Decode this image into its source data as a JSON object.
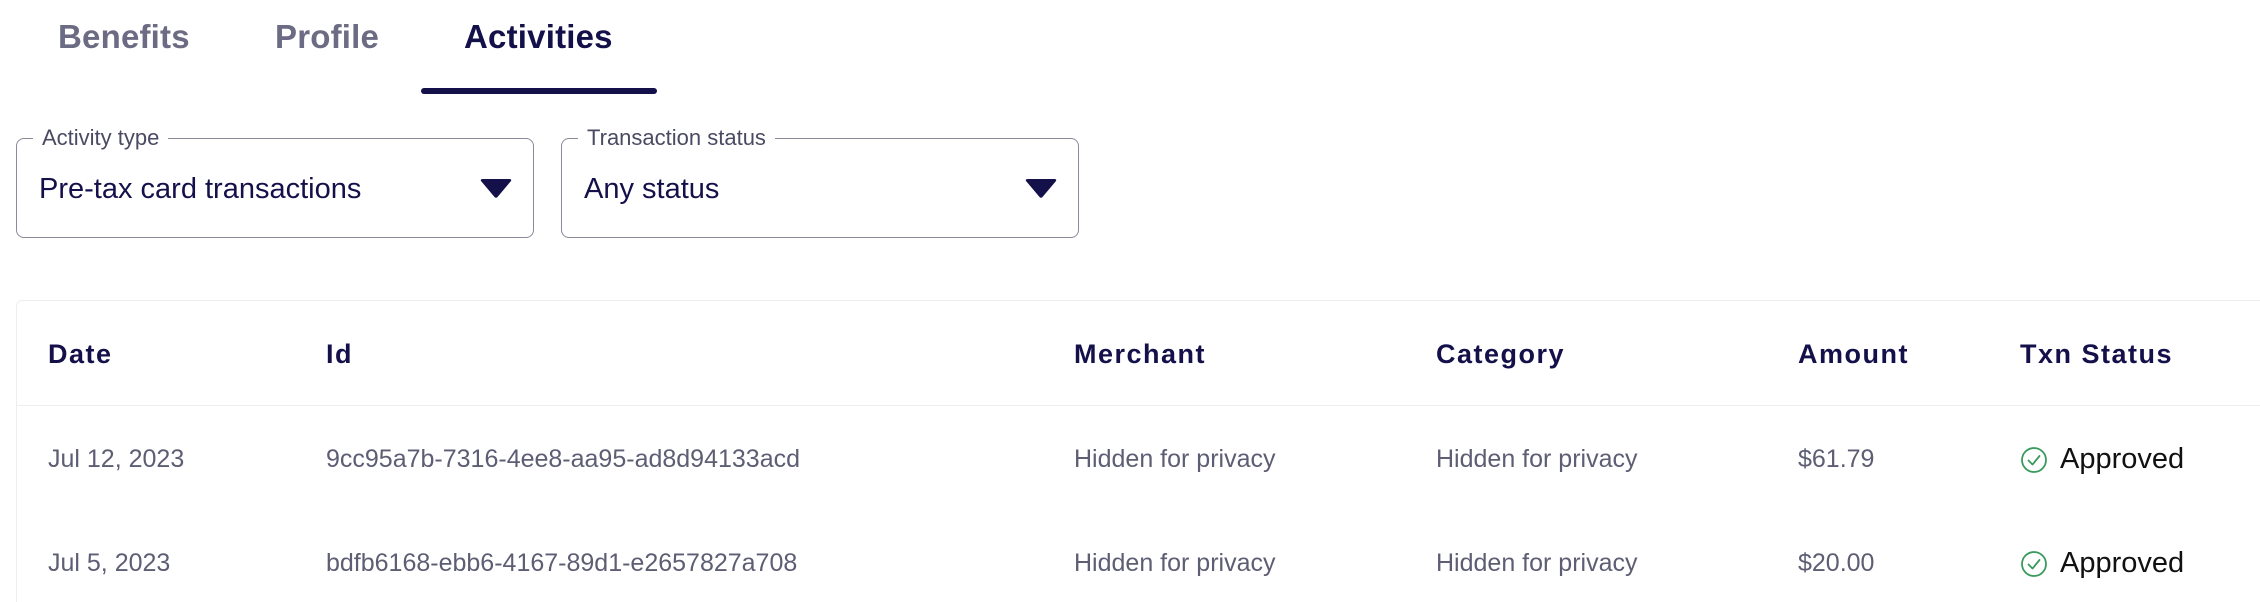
{
  "tabs": [
    {
      "label": "Benefits",
      "active": false
    },
    {
      "label": "Profile",
      "active": false
    },
    {
      "label": "Activities",
      "active": true
    }
  ],
  "filters": {
    "activity_type": {
      "label": "Activity type",
      "value": "Pre-tax card transactions"
    },
    "transaction_status": {
      "label": "Transaction status",
      "value": "Any status"
    }
  },
  "table": {
    "headers": {
      "date": "Date",
      "id": "Id",
      "merchant": "Merchant",
      "category": "Category",
      "amount": "Amount",
      "status": "Txn Status"
    },
    "rows": [
      {
        "date": "Jul 12, 2023",
        "id": "9cc95a7b-7316-4ee8-aa95-ad8d94133acd",
        "merchant": "Hidden for privacy",
        "category": "Hidden for privacy",
        "amount": "$61.79",
        "status": "Approved"
      },
      {
        "date": "Jul 5, 2023",
        "id": "bdfb6168-ebb6-4167-89d1-e2657827a708",
        "merchant": "Hidden for privacy",
        "category": "Hidden for privacy",
        "amount": "$20.00",
        "status": "Approved"
      }
    ]
  },
  "icons": {
    "dropdown": "caret-down-icon",
    "approved": "check-circle-icon"
  },
  "colors": {
    "primary": "#14104a",
    "tab_inactive": "#6b6b84",
    "approved": "#3a9a5b",
    "border": "#8a8a98"
  }
}
